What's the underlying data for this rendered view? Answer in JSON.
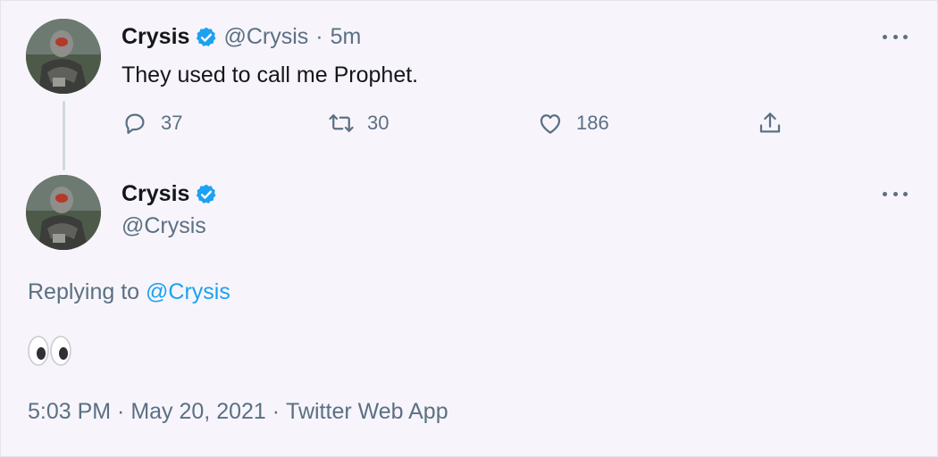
{
  "tweet1": {
    "name": "Crysis",
    "handle": "@Crysis",
    "separator": "·",
    "time": "5m",
    "text": "They used to call me Prophet.",
    "replies": "37",
    "retweets": "30",
    "likes": "186"
  },
  "tweet2": {
    "name": "Crysis",
    "handle": "@Crysis",
    "replying_prefix": "Replying to",
    "replying_handle": "@Crysis",
    "text_emoji": "eyes-emoji",
    "time": "5:03 PM",
    "date": "May 20, 2021",
    "source": "Twitter Web App",
    "separator": " · "
  },
  "colors": {
    "verified": "#1da1f2",
    "link": "#1da1f2",
    "secondary_text": "#5b7083",
    "background": "#f7f5fb"
  },
  "icons": [
    "verified-badge-icon",
    "more-icon",
    "reply-icon",
    "retweet-icon",
    "like-icon",
    "share-icon"
  ]
}
